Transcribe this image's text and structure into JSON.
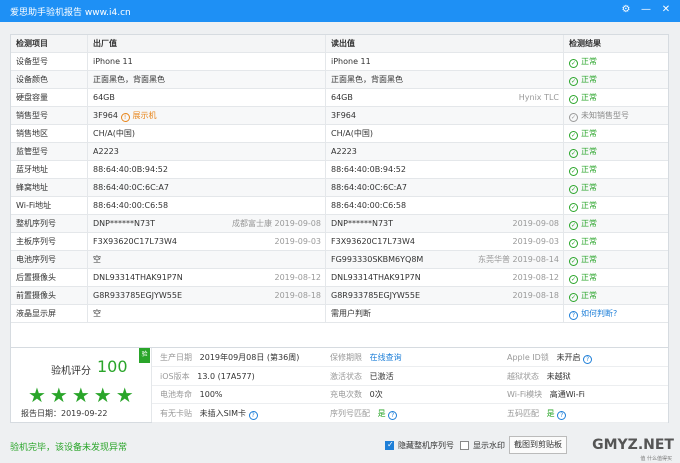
{
  "window": {
    "title": "爱思助手验机报告 www.i4.cn"
  },
  "table": {
    "headers": [
      "检测项目",
      "出厂值",
      "读出值",
      "检测结果"
    ],
    "rows": [
      {
        "name": "设备型号",
        "factory": "iPhone 11",
        "factory_note": "",
        "factory_warn": "",
        "read": "iPhone 11",
        "read_note": "",
        "result": "正常",
        "status": "ok"
      },
      {
        "name": "设备颜色",
        "factory": "正面黑色，背面黑色",
        "factory_note": "",
        "factory_warn": "",
        "read": "正面黑色，背面黑色",
        "read_note": "",
        "result": "正常",
        "status": "ok"
      },
      {
        "name": "硬盘容量",
        "factory": "64GB",
        "factory_note": "",
        "factory_warn": "",
        "read": "64GB",
        "read_note": "Hynix TLC",
        "result": "正常",
        "status": "ok"
      },
      {
        "name": "销售型号",
        "factory": "3F964",
        "factory_note": "",
        "factory_warn": "展示机",
        "read": "3F964",
        "read_note": "",
        "result": "未知销售型号",
        "status": "gray"
      },
      {
        "name": "销售地区",
        "factory": "CH/A(中国)",
        "factory_note": "",
        "factory_warn": "",
        "read": "CH/A(中国)",
        "read_note": "",
        "result": "正常",
        "status": "ok"
      },
      {
        "name": "监管型号",
        "factory": "A2223",
        "factory_note": "",
        "factory_warn": "",
        "read": "A2223",
        "read_note": "",
        "result": "正常",
        "status": "ok"
      },
      {
        "name": "蓝牙地址",
        "factory": "88:64:40:0B:94:52",
        "factory_note": "",
        "factory_warn": "",
        "read": "88:64:40:0B:94:52",
        "read_note": "",
        "result": "正常",
        "status": "ok"
      },
      {
        "name": "蜂窝地址",
        "factory": "88:64:40:0C:6C:A7",
        "factory_note": "",
        "factory_warn": "",
        "read": "88:64:40:0C:6C:A7",
        "read_note": "",
        "result": "正常",
        "status": "ok"
      },
      {
        "name": "Wi-Fi地址",
        "factory": "88:64:40:00:C6:58",
        "factory_note": "",
        "factory_warn": "",
        "read": "88:64:40:00:C6:58",
        "read_note": "",
        "result": "正常",
        "status": "ok"
      },
      {
        "name": "整机序列号",
        "factory": "DNP******N73T",
        "factory_note": "成都富士康 2019-09-08",
        "factory_warn": "",
        "read": "DNP******N73T",
        "read_note": "2019-09-08",
        "result": "正常",
        "status": "ok"
      },
      {
        "name": "主板序列号",
        "factory": "F3X93620C17L73W4",
        "factory_note": "2019-09-03",
        "factory_warn": "",
        "read": "F3X93620C17L73W4",
        "read_note": "2019-09-03",
        "result": "正常",
        "status": "ok"
      },
      {
        "name": "电池序列号",
        "factory": "空",
        "factory_note": "",
        "factory_warn": "",
        "read": "FG993330SKBM6YQ8M",
        "read_note": "东莞华普 2019-08-14",
        "result": "正常",
        "status": "ok"
      },
      {
        "name": "后置摄像头",
        "factory": "DNL93314THAK91P7N",
        "factory_note": "2019-08-12",
        "factory_warn": "",
        "read": "DNL93314THAK91P7N",
        "read_note": "2019-08-12",
        "result": "正常",
        "status": "ok"
      },
      {
        "name": "前置摄像头",
        "factory": "G8R933785EGJYW55E",
        "factory_note": "2019-08-18",
        "factory_warn": "",
        "read": "G8R933785EGJYW55E",
        "read_note": "2019-08-18",
        "result": "正常",
        "status": "ok"
      },
      {
        "name": "液晶显示屏",
        "factory": "空",
        "factory_note": "",
        "factory_warn": "",
        "read": "需用户判断",
        "read_note": "",
        "result": "如何判断?",
        "status": "link"
      }
    ]
  },
  "summary": {
    "score_label": "验机评分",
    "score": "100",
    "badge": "验",
    "stars": "★★★★★",
    "report_date_label": "报告日期：",
    "report_date": "2019-09-22",
    "items": [
      [
        {
          "k": "生产日期",
          "v": "2019年09月08日 (第36周)",
          "help": false
        },
        {
          "k": "保修期限",
          "v": "在线查询",
          "help": false,
          "link": true
        },
        {
          "k": "Apple ID锁",
          "v": "未开启",
          "help": true
        }
      ],
      [
        {
          "k": "iOS版本",
          "v": "13.0 (17A577)",
          "help": false
        },
        {
          "k": "激活状态",
          "v": "已激活",
          "help": false
        },
        {
          "k": "越狱状态",
          "v": "未越狱",
          "help": false
        }
      ],
      [
        {
          "k": "电池寿命",
          "v": "100%",
          "help": false
        },
        {
          "k": "充电次数",
          "v": "0次",
          "help": false
        },
        {
          "k": "Wi-Fi模块",
          "v": "高通Wi-Fi",
          "help": false
        }
      ],
      [
        {
          "k": "有无卡贴",
          "v": "未插入SIM卡",
          "help": true
        },
        {
          "k": "序列号匹配",
          "v": "是",
          "help": true,
          "green": true
        },
        {
          "k": "五码匹配",
          "v": "是",
          "help": true,
          "green": true
        }
      ]
    ]
  },
  "footer": {
    "verdict": "验机完毕，该设备未发现异常",
    "hide_serial_label": "隐藏整机序列号",
    "hide_serial_checked": true,
    "watermark_label": "显示水印",
    "watermark_checked": false,
    "copy_button": "截图到剪贴板",
    "brand_watermark": "GMYZ.NET",
    "brand_sub": "值 什么值得买"
  }
}
